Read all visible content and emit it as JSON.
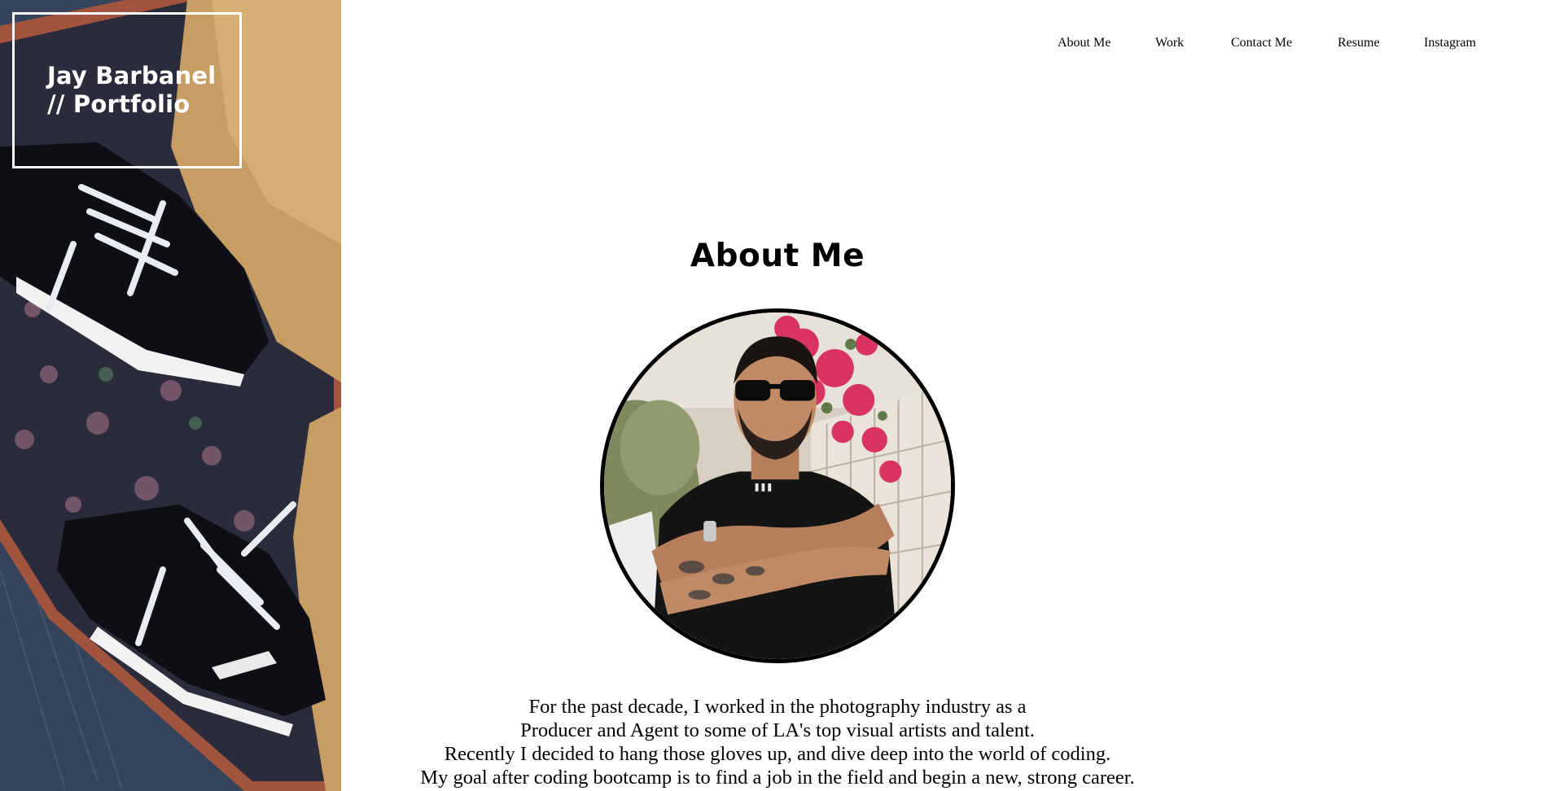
{
  "brand": {
    "line1": "Jay Barbanel",
    "line2": "// Portfolio"
  },
  "nav": {
    "items": [
      {
        "label": "About Me"
      },
      {
        "label": "Work"
      },
      {
        "label": "Contact Me"
      },
      {
        "label": "Resume"
      },
      {
        "label": "Instagram"
      }
    ]
  },
  "about": {
    "title": "About Me",
    "bio_lines": [
      "For the past decade, I worked in the photography industry as a",
      "Producer and Agent to some of LA's top visual artists and talent.",
      "Recently I decided to hang those gloves up, and dive deep into the world of coding.",
      "My goal after coding bootcamp is to find a job in the field and begin a new, strong career."
    ]
  },
  "colors": {
    "text": "#000000",
    "background": "#ffffff",
    "brand_text": "#ffffff"
  }
}
